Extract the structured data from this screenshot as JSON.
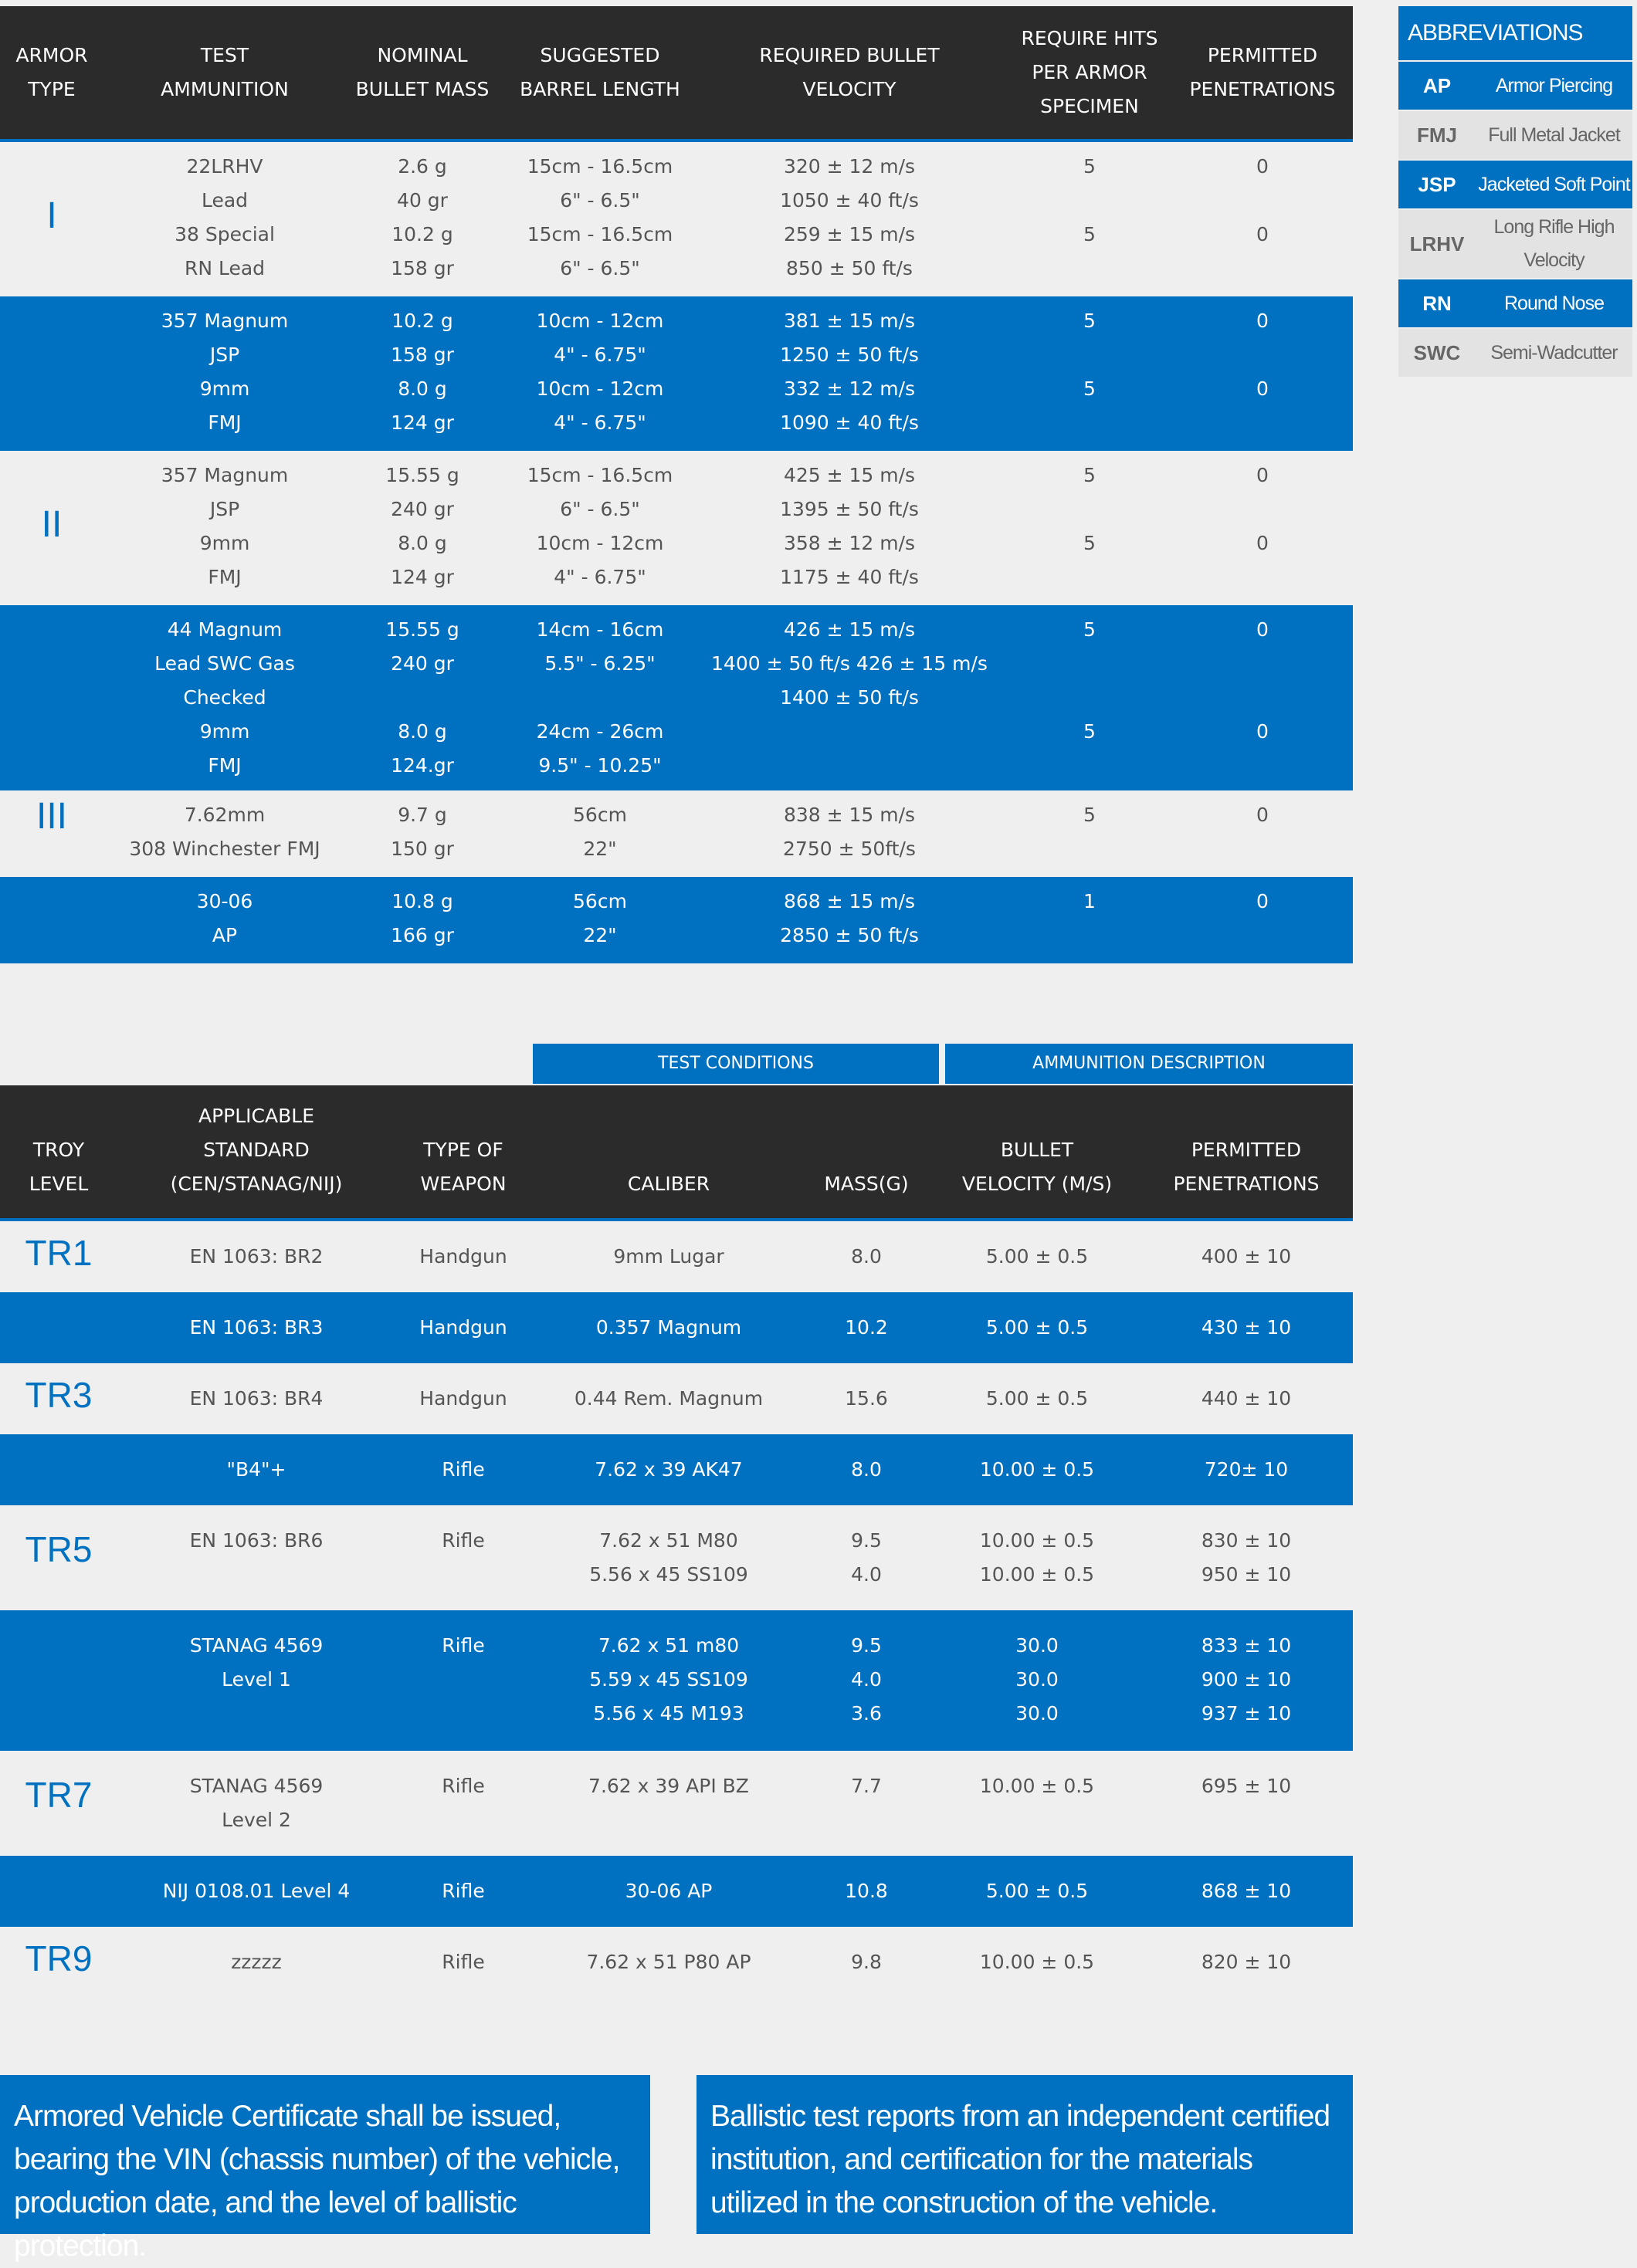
{
  "table1": {
    "headers": {
      "armor_type": "ARMOR\nTYPE",
      "test_ammo": "TEST\nAMMUNITION",
      "mass": "NOMINAL\nBULLET MASS",
      "barrel": "SUGGESTED\nBARREL LENGTH",
      "velocity": "REQUIRED BULLET\nVELOCITY",
      "hits": "REQUIRE HITS\nPER ARMOR\nSPECIMEN",
      "penetrations": "PERMITTED\nPENETRATIONS"
    },
    "rows": [
      {
        "level": "I",
        "ammo": "22LRHV\nLead\n38 Special\nRN Lead",
        "mass": "2.6 g\n40 gr\n10.2 g\n158 gr",
        "barrel": "15cm - 16.5cm\n6\" - 6.5\"\n15cm - 16.5cm\n6\" - 6.5\"",
        "velocity": "320 ± 12 m/s\n1050 ± 40 ft/s\n259 ± 15 m/s\n850 ± 50 ft/s",
        "hits": "5\n\n5\n",
        "pen": "0\n\n0\n"
      },
      {
        "level": "",
        "ammo": "357 Magnum\nJSP\n9mm\nFMJ",
        "mass": "10.2 g\n158 gr\n8.0 g\n124 gr",
        "barrel": "10cm - 12cm\n4\" - 6.75\"\n10cm - 12cm\n4\" - 6.75\"",
        "velocity": "381 ± 15 m/s\n1250 ± 50 ft/s\n332 ± 12 m/s\n1090 ± 40 ft/s",
        "hits": "5\n\n5\n",
        "pen": "0\n\n0\n"
      },
      {
        "level": "II",
        "ammo": "357 Magnum\nJSP\n9mm\nFMJ",
        "mass": "15.55 g\n240 gr\n8.0 g\n124 gr",
        "barrel": "15cm - 16.5cm\n6\" - 6.5\"\n10cm - 12cm\n4\" - 6.75\"",
        "velocity": "425 ± 15 m/s\n1395 ± 50 ft/s\n358 ± 12 m/s\n1175 ± 40 ft/s",
        "hits": "5\n\n5\n",
        "pen": "0\n\n0\n"
      },
      {
        "level": "",
        "ammo": "44 Magnum\nLead SWC Gas\nChecked\n9mm\nFMJ",
        "mass": "15.55 g\n240 gr\n\n8.0 g\n124.gr",
        "barrel": "14cm - 16cm\n5.5\" - 6.25\"\n\n24cm - 26cm\n9.5\" - 10.25\"",
        "velocity": "426 ± 15 m/s\n1400 ± 50 ft/s 426 ± 15 m/s\n1400 ± 50 ft/s\n\n",
        "hits": "5\n\n\n5\n",
        "pen": "0\n\n\n0\n"
      },
      {
        "level": "III",
        "ammo": "7.62mm\n308 Winchester FMJ",
        "mass": "9.7 g\n150 gr",
        "barrel": "56cm\n22\"",
        "velocity": "838 ± 15 m/s\n2750 ± 50ft/s",
        "hits": "5\n",
        "pen": "0\n"
      },
      {
        "level": "",
        "ammo": "30-06\nAP",
        "mass": "10.8 g\n166 gr",
        "barrel": "56cm\n22\"",
        "velocity": "868 ± 15 m/s\n2850 ± 50 ft/s",
        "hits": "1\n",
        "pen": "0\n"
      }
    ]
  },
  "abbreviations": {
    "title": "ABBREVIATIONS",
    "items": [
      {
        "key": "AP",
        "value": "Armor Piercing"
      },
      {
        "key": "FMJ",
        "value": "Full Metal Jacket"
      },
      {
        "key": "JSP",
        "value": "Jacketed Soft Point"
      },
      {
        "key": "LRHV",
        "value": "Long Rifle High\nVelocity"
      },
      {
        "key": "RN",
        "value": "Round Nose"
      },
      {
        "key": "SWC",
        "value": "Semi-Wadcutter"
      }
    ]
  },
  "table2": {
    "group_headers": {
      "test_conditions": "TEST CONDITIONS",
      "ammo_description": "AMMUNITION DESCRIPTION"
    },
    "headers": {
      "troy": "TROY\nLEVEL",
      "standard": "APPLICABLE\nSTANDARD\n(CEN/STANAG/NIJ)",
      "weapon": "TYPE OF\nWEAPON",
      "caliber": "CALIBER",
      "mass": "MASS(G)",
      "velocity": "BULLET\nVELOCITY (M/S)",
      "pen": "PERMITTED\nPENETRATIONS"
    },
    "rows": [
      {
        "level": "TR1",
        "standard": "EN 1063: BR2",
        "weapon": "Handgun",
        "caliber": "9mm Lugar",
        "mass": "8.0",
        "velocity": "5.00 ± 0.5",
        "pen": "400 ± 10"
      },
      {
        "level": "",
        "standard": "EN 1063: BR3",
        "weapon": "Handgun",
        "caliber": "0.357 Magnum",
        "mass": "10.2",
        "velocity": "5.00 ± 0.5",
        "pen": "430 ± 10"
      },
      {
        "level": "TR3",
        "standard": "EN 1063: BR4",
        "weapon": "Handgun",
        "caliber": "0.44 Rem. Magnum",
        "mass": "15.6",
        "velocity": "5.00 ± 0.5",
        "pen": "440 ± 10"
      },
      {
        "level": "",
        "standard": "\"B4\"+",
        "weapon": "Rifle",
        "caliber": "7.62 x 39 AK47",
        "mass": "8.0",
        "velocity": "10.00 ± 0.5",
        "pen": "720± 10"
      },
      {
        "level": "TR5",
        "standard": "EN 1063: BR6",
        "weapon": "Rifle",
        "caliber": "7.62 x 51 M80\n5.56 x 45 SS109",
        "mass": "9.5\n4.0",
        "velocity": "10.00 ± 0.5\n10.00 ± 0.5",
        "pen": "830 ± 10\n950 ± 10"
      },
      {
        "level": "",
        "standard": "STANAG 4569\nLevel 1",
        "weapon": "Rifle",
        "caliber": "7.62 x 51 m80\n5.59 x 45 SS109\n5.56 x 45 M193",
        "mass": "9.5\n4.0\n3.6",
        "velocity": "30.0\n30.0\n30.0",
        "pen": "833 ± 10\n900 ± 10\n937 ± 10"
      },
      {
        "level": "TR7",
        "standard": "STANAG 4569\nLevel 2",
        "weapon": "Rifle",
        "caliber": "7.62 x 39 API BZ",
        "mass": "7.7",
        "velocity": "10.00 ± 0.5",
        "pen": "695 ± 10"
      },
      {
        "level": "",
        "standard": "NIJ 0108.01 Level 4",
        "weapon": "Rifle",
        "caliber": "30-06 AP",
        "mass": "10.8",
        "velocity": "5.00 ± 0.5",
        "pen": "868 ± 10"
      },
      {
        "level": "TR9",
        "standard": "zzzzz",
        "weapon": "Rifle",
        "caliber": "7.62 x 51 P80 AP",
        "mass": "9.8",
        "velocity": "10.00 ± 0.5",
        "pen": "820 ± 10"
      }
    ]
  },
  "notes": {
    "left": "Armored Vehicle Certificate shall be issued, bearing the VIN (chassis number) of the vehicle, production date, and the level of ballistic protection.",
    "right": "Ballistic test reports from an independent certified institution, and certification for the materials utilized in the construction of the vehicle."
  },
  "colors": {
    "accent": "#0070c0",
    "header": "#2b2b2b",
    "background": "#efefef"
  }
}
